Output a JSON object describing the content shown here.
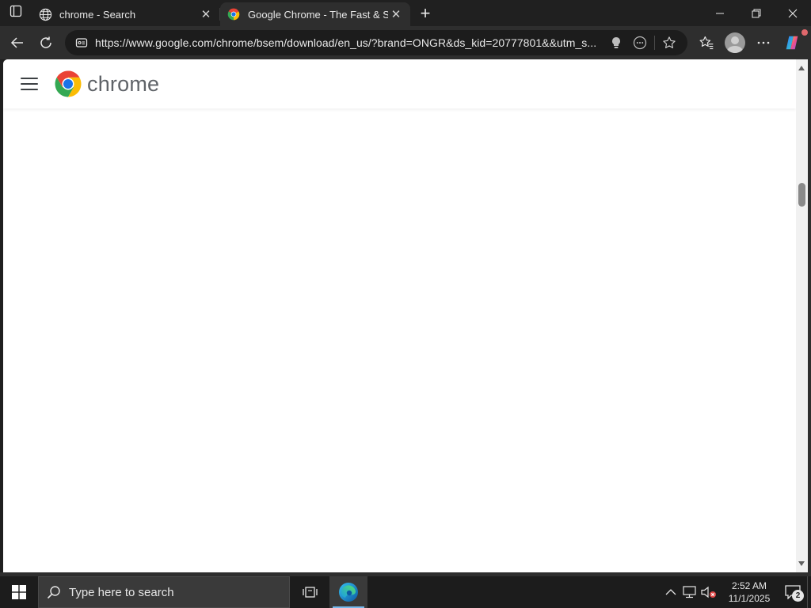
{
  "browser": {
    "tabs": [
      {
        "title": "chrome - Search",
        "icon": "globe-icon",
        "active": false
      },
      {
        "title": "Google Chrome - The Fast & Secu",
        "icon": "chrome-icon",
        "active": true
      }
    ],
    "new_tab": "+",
    "address": {
      "url": "https://www.google.com/chrome/bsem/download/en_us/?brand=ONGR&ds_kid=20777801&&utm_s..."
    },
    "toolbar_icons": [
      "back-icon",
      "refresh-icon",
      "site-info-icon",
      "lightbulb-icon",
      "reading-mode-icon",
      "favorite-star-icon",
      "favorites-icon",
      "profile-icon",
      "more-icon",
      "copilot-icon"
    ]
  },
  "page": {
    "logo_text": "chrome",
    "colors": {
      "red": "#ea4335",
      "yellow": "#fbbc04",
      "green": "#34a853",
      "blue": "#1a73e8"
    }
  },
  "taskbar": {
    "search_placeholder": "Type here to search",
    "time": "2:52 AM",
    "date": "11/1/2025",
    "notification_count": "2",
    "accent": "#76b9ed"
  }
}
